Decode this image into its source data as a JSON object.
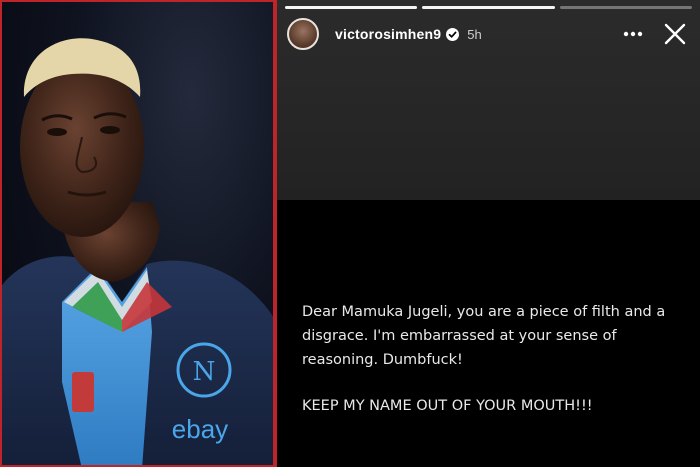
{
  "story": {
    "username": "victorosimhen9",
    "time": "5h",
    "progress": {
      "segments": 3,
      "completed": 2
    },
    "message": {
      "paragraph_1": "Dear Mamuka Jugeli, you are a piece of filth and a disgrace. I'm embarrassed at your sense of reasoning. Dumbfuck!",
      "paragraph_2": "KEEP MY NAME OUT OF YOUR MOUTH!!!"
    }
  },
  "photo": {
    "sponsor_logo_text": "ebay",
    "crest_letter": "N"
  },
  "colors": {
    "divider": "#c0242b",
    "story_bg": "#000000",
    "story_top_bg": "#262626",
    "jersey": "#1c2b4b",
    "shirt_blue": "#3f8fd4",
    "hair": "#e4d6a8"
  },
  "icons": [
    "verified-badge-icon",
    "more-options-icon",
    "close-icon"
  ]
}
